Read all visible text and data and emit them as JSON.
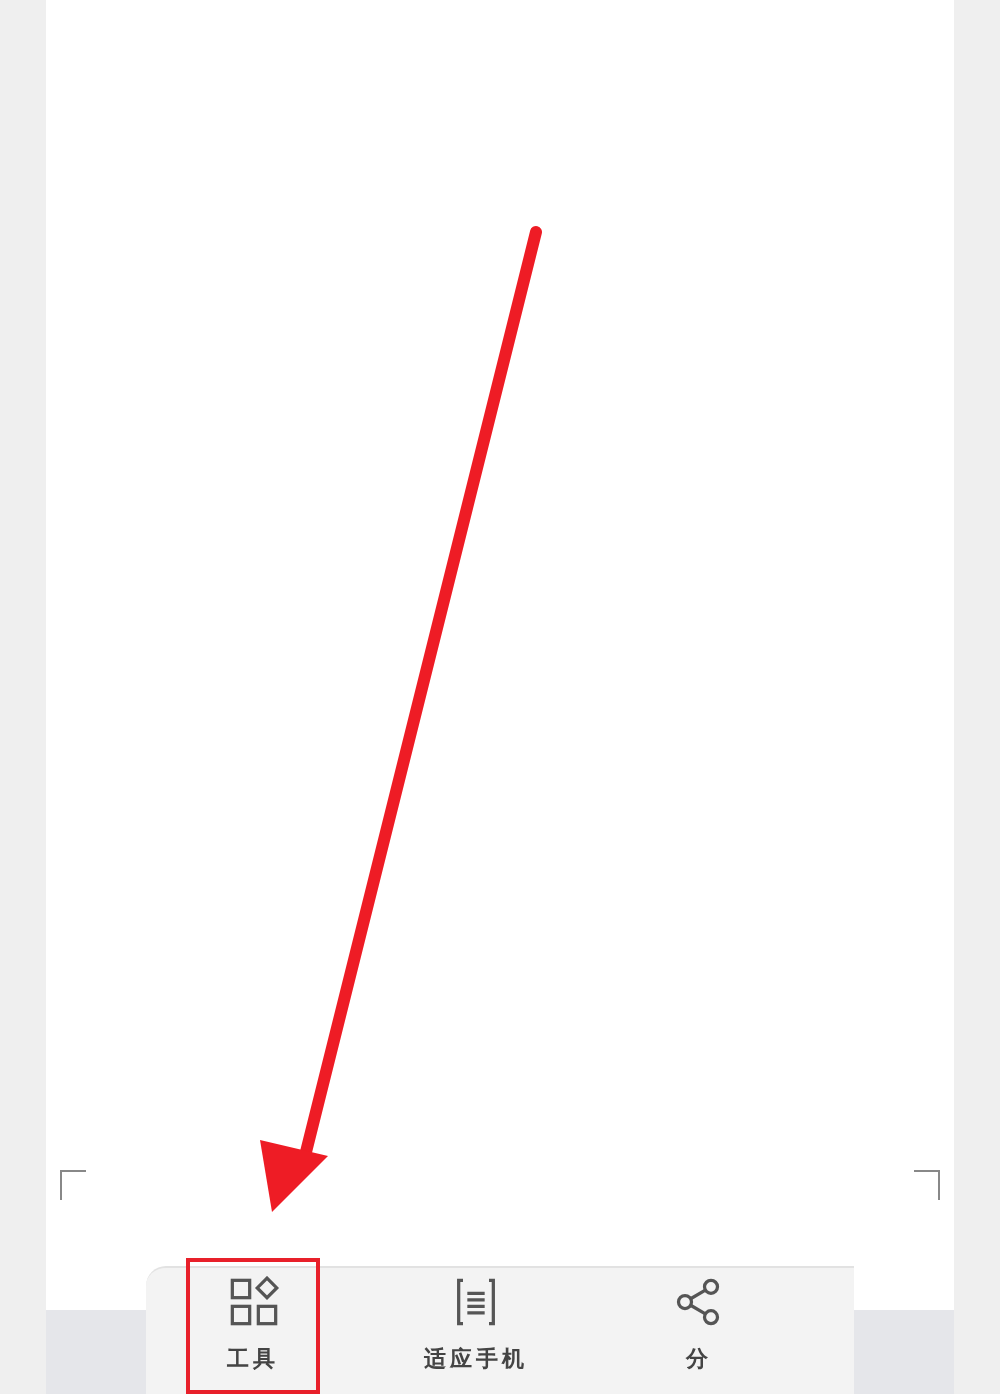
{
  "toolbar": {
    "items": [
      {
        "label": "工具",
        "kind": "tools",
        "highlighted": true
      },
      {
        "label": "适应手机",
        "kind": "fit",
        "highlighted": false
      },
      {
        "label": "分",
        "kind": "share",
        "highlighted": false
      }
    ]
  }
}
